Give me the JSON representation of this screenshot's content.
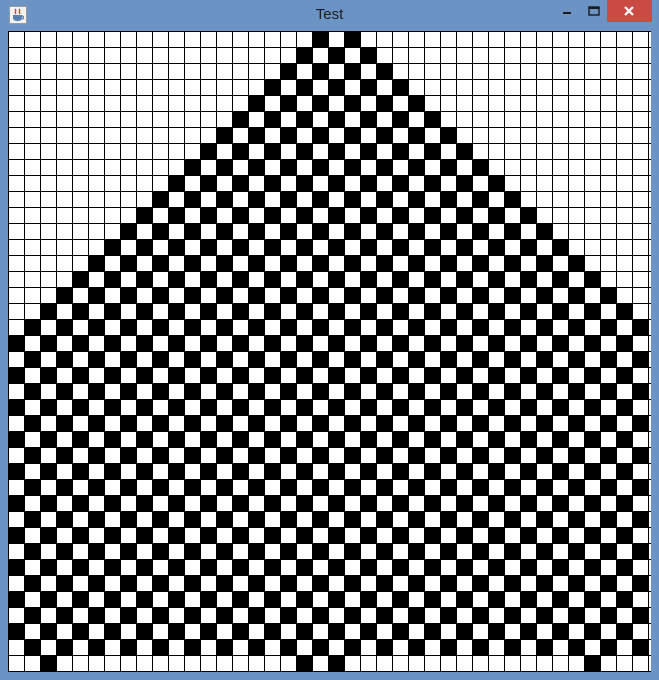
{
  "window": {
    "title": "Test",
    "icon": "java-cup-icon",
    "controls": {
      "minimize": "minimize-icon",
      "maximize": "maximize-icon",
      "close": "close-icon"
    }
  },
  "grid": {
    "columns": 40,
    "rows": 40,
    "fill_color": "#000000",
    "empty_color": "#ffffff",
    "line_color": "#000000",
    "filled_rows": [
      [
        19,
        21
      ],
      [
        18,
        20,
        22
      ],
      [
        17,
        19,
        21,
        23
      ],
      [
        16,
        18,
        20,
        22,
        24
      ],
      [
        15,
        17,
        19,
        21,
        23,
        25
      ],
      [
        14,
        16,
        18,
        20,
        22,
        24,
        26
      ],
      [
        13,
        15,
        17,
        19,
        21,
        23,
        25,
        27
      ],
      [
        12,
        14,
        16,
        18,
        20,
        22,
        24,
        26,
        28
      ],
      [
        11,
        13,
        15,
        17,
        19,
        21,
        23,
        25,
        27,
        29
      ],
      [
        10,
        12,
        14,
        16,
        18,
        20,
        22,
        24,
        26,
        28,
        30
      ],
      [
        9,
        11,
        13,
        15,
        17,
        19,
        21,
        23,
        25,
        27,
        29,
        31
      ],
      [
        8,
        10,
        12,
        14,
        16,
        18,
        20,
        22,
        24,
        26,
        28,
        30,
        32
      ],
      [
        7,
        9,
        11,
        13,
        15,
        17,
        19,
        21,
        23,
        25,
        27,
        29,
        31,
        33
      ],
      [
        6,
        8,
        10,
        12,
        14,
        16,
        18,
        20,
        22,
        24,
        26,
        28,
        30,
        32,
        34
      ],
      [
        5,
        7,
        9,
        11,
        13,
        15,
        17,
        19,
        21,
        23,
        25,
        27,
        29,
        31,
        33,
        35
      ],
      [
        4,
        6,
        8,
        10,
        12,
        14,
        16,
        18,
        20,
        22,
        24,
        26,
        28,
        30,
        32,
        34,
        36
      ],
      [
        3,
        5,
        7,
        9,
        11,
        13,
        15,
        17,
        19,
        21,
        23,
        25,
        27,
        29,
        31,
        33,
        35,
        37
      ],
      [
        2,
        4,
        6,
        8,
        10,
        12,
        14,
        16,
        18,
        20,
        22,
        24,
        26,
        28,
        30,
        32,
        34,
        36,
        38
      ],
      [
        1,
        3,
        5,
        7,
        9,
        11,
        13,
        15,
        17,
        19,
        21,
        23,
        25,
        27,
        29,
        31,
        33,
        35,
        37,
        39
      ],
      [
        0,
        2,
        4,
        6,
        8,
        10,
        12,
        14,
        16,
        18,
        20,
        22,
        24,
        26,
        28,
        30,
        32,
        34,
        36,
        38
      ],
      [
        1,
        3,
        5,
        7,
        9,
        11,
        13,
        15,
        17,
        19,
        21,
        23,
        25,
        27,
        29,
        31,
        33,
        35,
        37,
        39
      ],
      [
        0,
        2,
        4,
        6,
        8,
        10,
        12,
        14,
        16,
        18,
        20,
        22,
        24,
        26,
        28,
        30,
        32,
        34,
        36,
        38
      ],
      [
        1,
        3,
        5,
        7,
        9,
        11,
        13,
        15,
        17,
        19,
        21,
        23,
        25,
        27,
        29,
        31,
        33,
        35,
        37,
        39
      ],
      [
        0,
        2,
        4,
        6,
        8,
        10,
        12,
        14,
        16,
        18,
        20,
        22,
        24,
        26,
        28,
        30,
        32,
        34,
        36,
        38
      ],
      [
        1,
        3,
        5,
        7,
        9,
        11,
        13,
        15,
        17,
        19,
        21,
        23,
        25,
        27,
        29,
        31,
        33,
        35,
        37,
        39
      ],
      [
        0,
        2,
        4,
        6,
        8,
        10,
        12,
        14,
        16,
        18,
        20,
        22,
        24,
        26,
        28,
        30,
        32,
        34,
        36,
        38
      ],
      [
        1,
        3,
        5,
        7,
        9,
        11,
        13,
        15,
        17,
        19,
        21,
        23,
        25,
        27,
        29,
        31,
        33,
        35,
        37,
        39
      ],
      [
        0,
        2,
        4,
        6,
        8,
        10,
        12,
        14,
        16,
        18,
        20,
        22,
        24,
        26,
        28,
        30,
        32,
        34,
        36,
        38
      ],
      [
        1,
        3,
        5,
        7,
        9,
        11,
        13,
        15,
        17,
        19,
        21,
        23,
        25,
        27,
        29,
        31,
        33,
        35,
        37,
        39
      ],
      [
        0,
        2,
        4,
        6,
        8,
        10,
        12,
        14,
        16,
        18,
        20,
        22,
        24,
        26,
        28,
        30,
        32,
        34,
        36,
        38
      ],
      [
        1,
        3,
        5,
        7,
        9,
        11,
        13,
        15,
        17,
        19,
        21,
        23,
        25,
        27,
        29,
        31,
        33,
        35,
        37,
        39
      ],
      [
        0,
        2,
        4,
        6,
        8,
        10,
        12,
        14,
        16,
        18,
        20,
        22,
        24,
        26,
        28,
        30,
        32,
        34,
        36,
        38
      ],
      [
        1,
        3,
        5,
        7,
        9,
        11,
        13,
        15,
        17,
        19,
        21,
        23,
        25,
        27,
        29,
        31,
        33,
        35,
        37,
        39
      ],
      [
        0,
        2,
        4,
        6,
        8,
        10,
        12,
        14,
        16,
        18,
        20,
        22,
        24,
        26,
        28,
        30,
        32,
        34,
        36,
        38
      ],
      [
        1,
        3,
        5,
        7,
        9,
        11,
        13,
        15,
        17,
        19,
        21,
        23,
        25,
        27,
        29,
        31,
        33,
        35,
        37,
        39
      ],
      [
        0,
        2,
        4,
        6,
        8,
        10,
        12,
        14,
        16,
        18,
        20,
        22,
        24,
        26,
        28,
        30,
        32,
        34,
        36,
        38
      ],
      [
        1,
        3,
        5,
        7,
        9,
        11,
        13,
        15,
        17,
        19,
        21,
        23,
        25,
        27,
        29,
        31,
        33,
        35,
        37,
        39
      ],
      [
        0,
        2,
        4,
        6,
        8,
        10,
        12,
        14,
        16,
        18,
        20,
        22,
        24,
        26,
        28,
        30,
        32,
        34,
        36,
        38
      ],
      [
        1,
        3,
        5,
        7,
        9,
        11,
        13,
        15,
        17,
        19,
        21,
        23,
        25,
        27,
        29,
        31,
        33,
        35,
        37,
        39
      ],
      [
        2,
        18,
        20,
        36
      ]
    ]
  }
}
